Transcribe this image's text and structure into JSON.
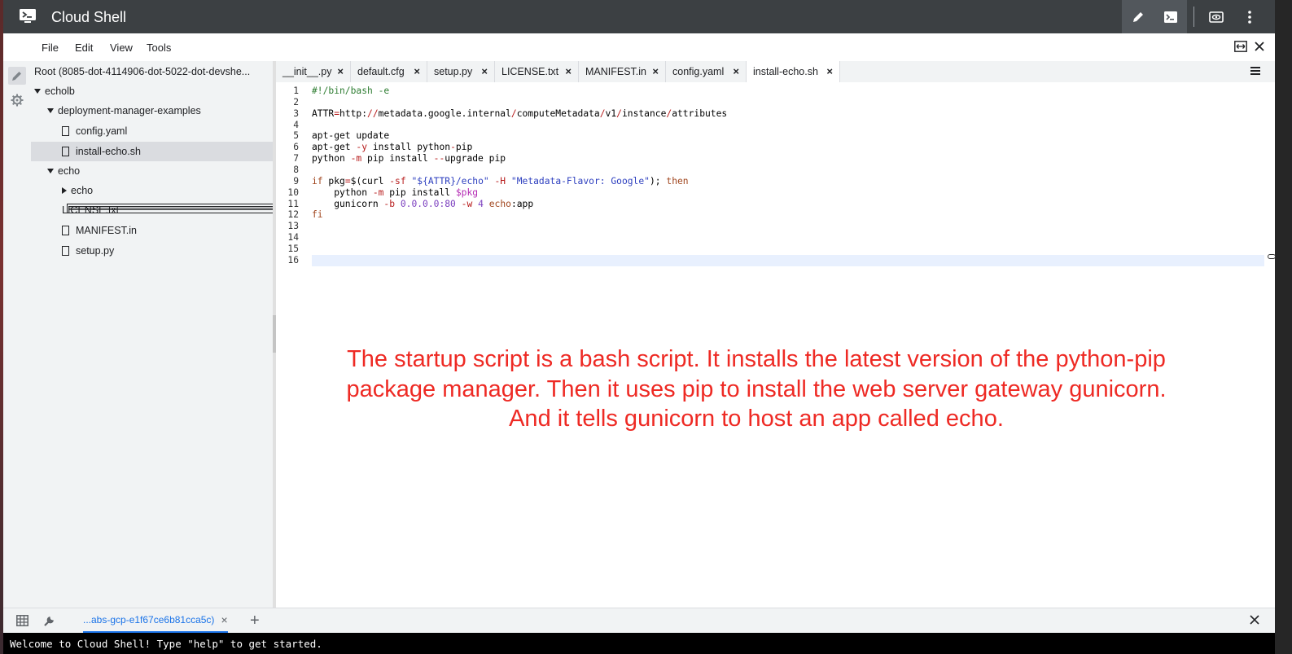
{
  "app": {
    "title": "Cloud Shell"
  },
  "menu": [
    "File",
    "Edit",
    "View",
    "Tools"
  ],
  "filetree": {
    "root": "Root (8085-dot-4114906-dot-5022-dot-devshe...",
    "items": [
      {
        "label": "echolb",
        "type": "folder-open"
      },
      {
        "label": "deployment-manager-examples",
        "type": "folder-open"
      },
      {
        "label": "config.yaml",
        "type": "file"
      },
      {
        "label": "install-echo.sh",
        "type": "file",
        "selected": true
      },
      {
        "label": "echo",
        "type": "folder-open"
      },
      {
        "label": "echo",
        "type": "folder-closed"
      },
      {
        "label": "LICENSE.txt",
        "type": "file-text"
      },
      {
        "label": "MANIFEST.in",
        "type": "file"
      },
      {
        "label": "setup.py",
        "type": "file"
      }
    ]
  },
  "tabs": [
    {
      "label": "__init__.py",
      "close": "×"
    },
    {
      "label": "default.cfg",
      "close": "×"
    },
    {
      "label": "setup.py",
      "close": "×"
    },
    {
      "label": "LICENSE.txt",
      "close": "×"
    },
    {
      "label": "MANIFEST.in",
      "close": "×"
    },
    {
      "label": "config.yaml",
      "close": "×"
    },
    {
      "label": "install-echo.sh",
      "close": "×",
      "active": true
    }
  ],
  "code": {
    "line_numbers": [
      "1",
      "2",
      "3",
      "4",
      "5",
      "6",
      "7",
      "8",
      "9",
      "10",
      "11",
      "12",
      "13",
      "14",
      "15",
      "16"
    ],
    "current_line": 16
  },
  "annotation": {
    "line1": "The startup script is a bash script. It installs the latest version of the python-pip",
    "line2": "package manager. Then it uses pip to install the web server gateway gunicorn.",
    "line3": "And it tells gunicorn to host an app called echo."
  },
  "terminal": {
    "tab_label": "...abs-gcp-e1f67ce6b81cca5c)",
    "tab_close": "×",
    "add": "+",
    "welcome": "Welcome to Cloud Shell! Type \"help\" to get started."
  },
  "colors": {
    "titlebar": "#3c4043",
    "annotation": "#ee2a24",
    "accent": "#1a73e8"
  }
}
